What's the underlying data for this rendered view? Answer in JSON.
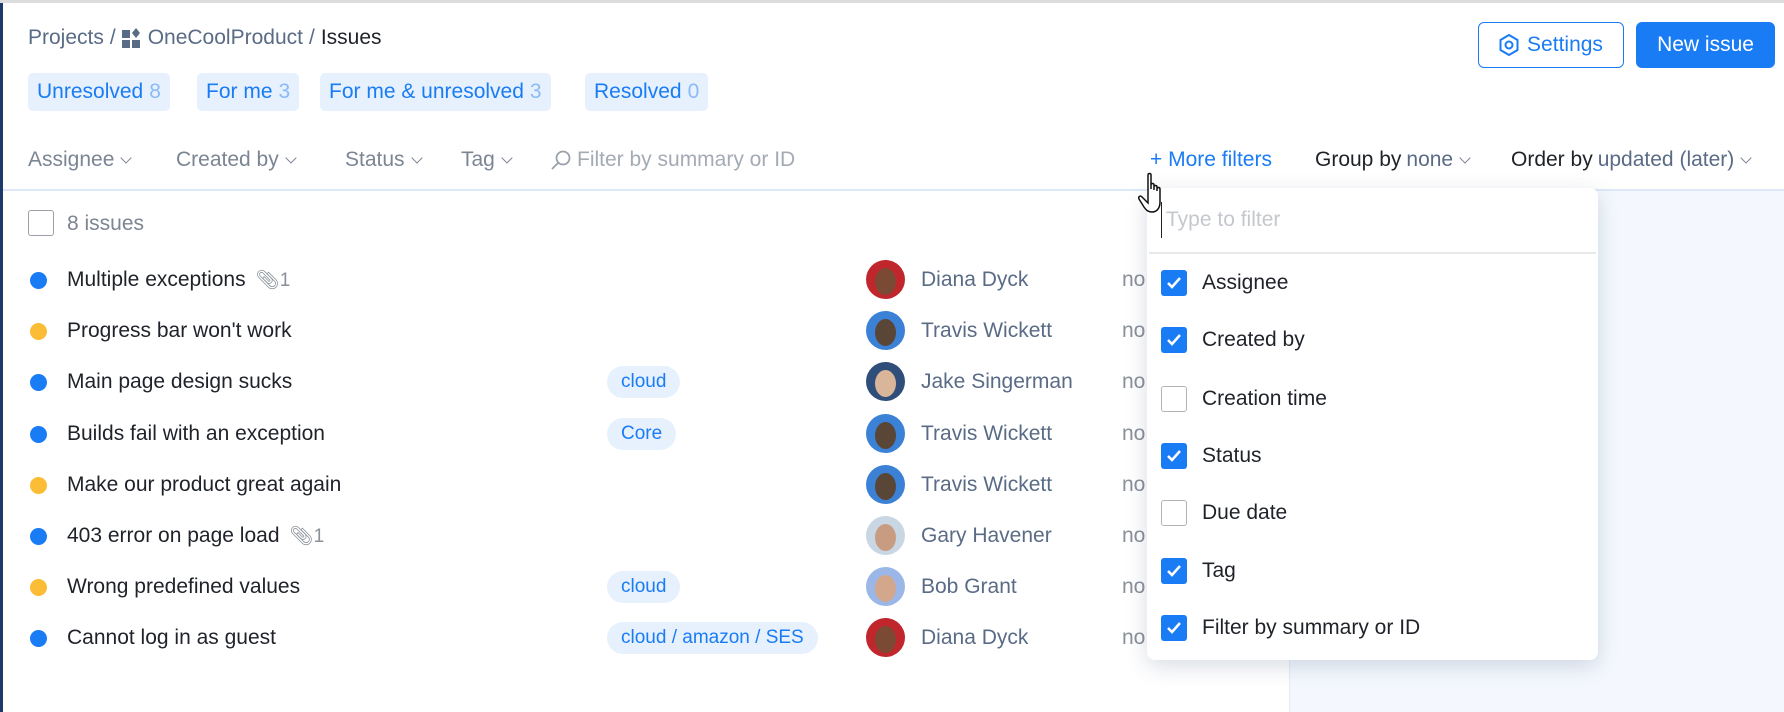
{
  "breadcrumb": {
    "projects": "Projects",
    "sep": "/",
    "project": "OneCoolProduct",
    "current": "Issues"
  },
  "header": {
    "settings": "Settings",
    "new_issue": "New issue"
  },
  "tabs": [
    {
      "label": "Unresolved",
      "count": "8"
    },
    {
      "label": "For me",
      "count": "3"
    },
    {
      "label": "For me & unresolved",
      "count": "3"
    },
    {
      "label": "Resolved",
      "count": "0"
    }
  ],
  "filters": {
    "assignee": "Assignee",
    "created_by": "Created by",
    "status": "Status",
    "tag": "Tag",
    "search_placeholder": "Filter by summary or ID",
    "more_filters": "+ More filters",
    "group_by_label": "Group by",
    "group_by_value": "none",
    "order_by_label": "Order by",
    "order_by_value": "updated (later)"
  },
  "list": {
    "count_label": "8 issues",
    "issues": [
      {
        "title": "Multiple exceptions",
        "status": "blue",
        "attachments": "1",
        "tag": "",
        "assignee": "Diana Dyck",
        "extra": "no"
      },
      {
        "title": "Progress bar won't work",
        "status": "yellow",
        "attachments": "",
        "tag": "",
        "assignee": "Travis Wickett",
        "extra": "no"
      },
      {
        "title": "Main page design sucks",
        "status": "blue",
        "attachments": "",
        "tag": "cloud",
        "assignee": "Jake Singerman",
        "extra": "no"
      },
      {
        "title": "Builds fail with an exception",
        "status": "blue",
        "attachments": "",
        "tag": "Core",
        "assignee": "Travis Wickett",
        "extra": "no"
      },
      {
        "title": "Make our product great again",
        "status": "yellow",
        "attachments": "",
        "tag": "",
        "assignee": "Travis Wickett",
        "extra": "no"
      },
      {
        "title": "403 error on page load",
        "status": "blue",
        "attachments": "1",
        "tag": "",
        "assignee": "Gary Havener",
        "extra": "no"
      },
      {
        "title": "Wrong predefined values",
        "status": "yellow",
        "attachments": "",
        "tag": "cloud",
        "assignee": "Bob Grant",
        "extra": "no"
      },
      {
        "title": "Cannot log in as guest",
        "status": "blue",
        "attachments": "",
        "tag": "cloud / amazon / SES",
        "assignee": "Diana Dyck",
        "extra": "no"
      }
    ]
  },
  "dropdown": {
    "placeholder": "Type to filter",
    "options": [
      {
        "label": "Assignee",
        "checked": true
      },
      {
        "label": "Created by",
        "checked": true
      },
      {
        "label": "Creation time",
        "checked": false
      },
      {
        "label": "Status",
        "checked": true
      },
      {
        "label": "Due date",
        "checked": false
      },
      {
        "label": "Tag",
        "checked": true
      },
      {
        "label": "Filter by summary or ID",
        "checked": true
      }
    ]
  },
  "colors": {
    "accent": "#1a7cf5",
    "blue": "#1a7cf5",
    "yellow": "#fbbd36"
  }
}
